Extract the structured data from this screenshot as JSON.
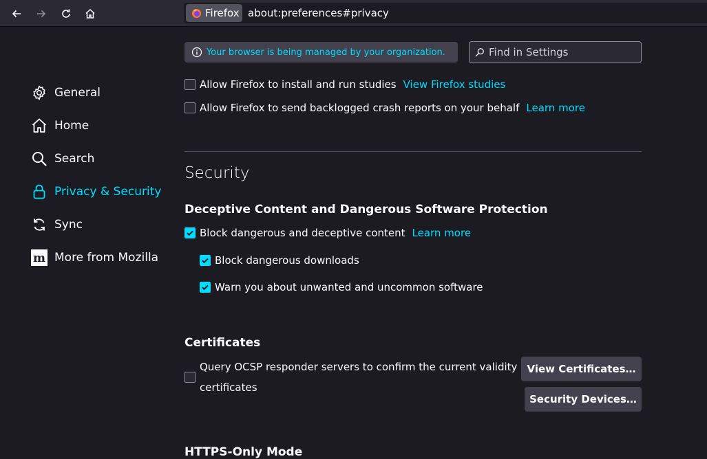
{
  "toolbar": {
    "identity_label": "Firefox",
    "url": "about:preferences#privacy"
  },
  "policy_message": "Your browser is being managed by your organization.",
  "search": {
    "placeholder": "Find in Settings"
  },
  "sidebar": {
    "items": [
      {
        "label": "General",
        "icon": "gear-icon"
      },
      {
        "label": "Home",
        "icon": "home-icon"
      },
      {
        "label": "Search",
        "icon": "search-icon"
      },
      {
        "label": "Privacy & Security",
        "icon": "lock-icon",
        "selected": true
      },
      {
        "label": "Sync",
        "icon": "sync-icon"
      },
      {
        "label": "More from Mozilla",
        "icon": "mozilla-icon"
      }
    ]
  },
  "data_collection": {
    "studies_label": "Allow Firefox to install and run studies",
    "studies_link": "View Firefox studies",
    "studies_checked": false,
    "crash_label": "Allow Firefox to send backlogged crash reports on your behalf",
    "crash_link": "Learn more",
    "crash_checked": false
  },
  "security": {
    "title": "Security",
    "deceptive_title": "Deceptive Content and Dangerous Software Protection",
    "block_deceptive_label": "Block dangerous and deceptive content",
    "block_deceptive_link": "Learn more",
    "block_deceptive_checked": true,
    "block_downloads_label": "Block dangerous downloads",
    "block_downloads_checked": true,
    "warn_unwanted_label": "Warn you about unwanted and uncommon software",
    "warn_unwanted_checked": true,
    "certificates_title": "Certificates",
    "ocsp_label_line1": "Query OCSP responder servers to confirm the current validity of",
    "ocsp_label_line2": "certificates",
    "ocsp_checked": false,
    "view_certificates_button": "View Certificates…",
    "security_devices_button": "Security Devices…",
    "https_only_title": "HTTPS-Only Mode"
  },
  "colors": {
    "accent": "#00ddff",
    "background": "#1c1b22",
    "toolbar": "#2b2a33",
    "button": "#42414d"
  }
}
